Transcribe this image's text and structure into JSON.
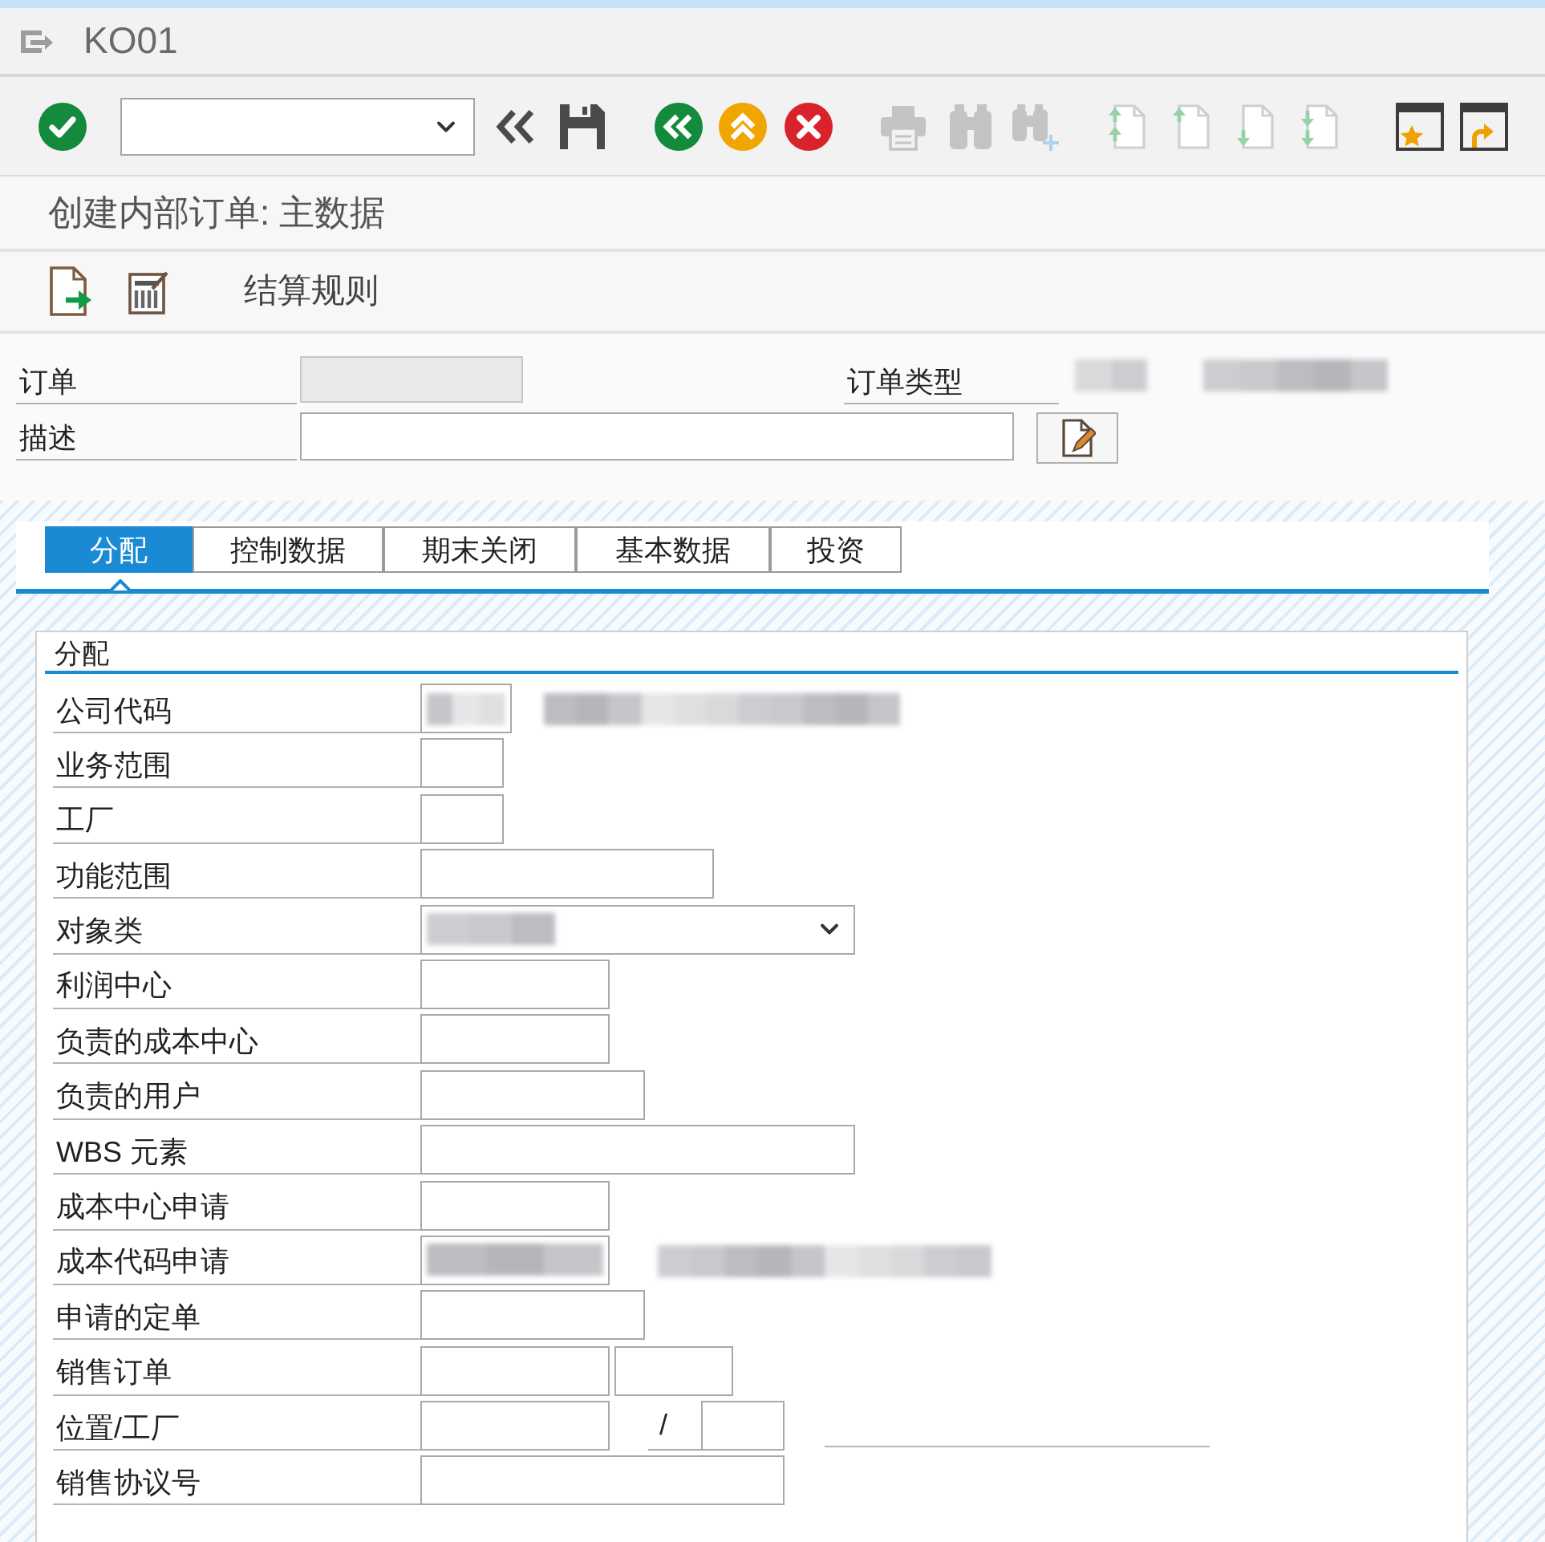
{
  "window": {
    "title": "KO01"
  },
  "toolbar": {
    "buttons": [
      {
        "disabled": false
      },
      {
        "disabled": false
      },
      {
        "disabled": false
      },
      {
        "disabled": false
      },
      {
        "disabled": false
      },
      {
        "disabled": false
      },
      {
        "disabled": true
      },
      {
        "disabled": true
      },
      {
        "disabled": true
      },
      {
        "disabled": true
      },
      {
        "disabled": true
      },
      {
        "disabled": true
      },
      {
        "disabled": true
      },
      {
        "disabled": false
      },
      {
        "disabled": false
      }
    ]
  },
  "screen_title": "创建内部订单: 主数据",
  "app_toolbar": {
    "buttons": [
      {
        "label": "结算规则"
      }
    ]
  },
  "header": {
    "fields": [
      {
        "label": "订单",
        "kind": "display"
      },
      {
        "label": "订单类型",
        "kind": "blurred"
      },
      {
        "label": "描述",
        "kind": "input"
      }
    ]
  },
  "tabs": [
    {
      "label": "分配",
      "selected": true
    },
    {
      "label": "控制数据",
      "selected": false
    },
    {
      "label": "期末关闭",
      "selected": false
    },
    {
      "label": "基本数据",
      "selected": false
    },
    {
      "label": "投资",
      "selected": false
    }
  ],
  "panel": {
    "title": "分配",
    "rows": [
      {
        "label": "公司代码",
        "kind": "input",
        "blurred": true
      },
      {
        "label": "业务范围",
        "kind": "input",
        "blurred": false
      },
      {
        "label": "工厂",
        "kind": "input",
        "blurred": false
      },
      {
        "label": "功能范围",
        "kind": "input",
        "blurred": false
      },
      {
        "label": "对象类",
        "kind": "dropdown",
        "blurred": true
      },
      {
        "label": "利润中心",
        "kind": "input",
        "blurred": false
      },
      {
        "label": "负责的成本中心",
        "kind": "input",
        "blurred": false
      },
      {
        "label": "负责的用户",
        "kind": "input",
        "blurred": false
      },
      {
        "label": "WBS 元素",
        "kind": "input",
        "blurred": false
      },
      {
        "label": "成本中心申请",
        "kind": "input",
        "blurred": false
      },
      {
        "label": "成本代码申请",
        "kind": "input",
        "blurred": true
      },
      {
        "label": "申请的定单",
        "kind": "input",
        "blurred": false
      },
      {
        "label": "销售订单",
        "kind": "pair",
        "blurred": false
      },
      {
        "label": "位置/工厂",
        "kind": "location",
        "separator": "/",
        "blurred": false
      },
      {
        "label": "销售协议号",
        "kind": "input",
        "blurred": false
      }
    ]
  }
}
